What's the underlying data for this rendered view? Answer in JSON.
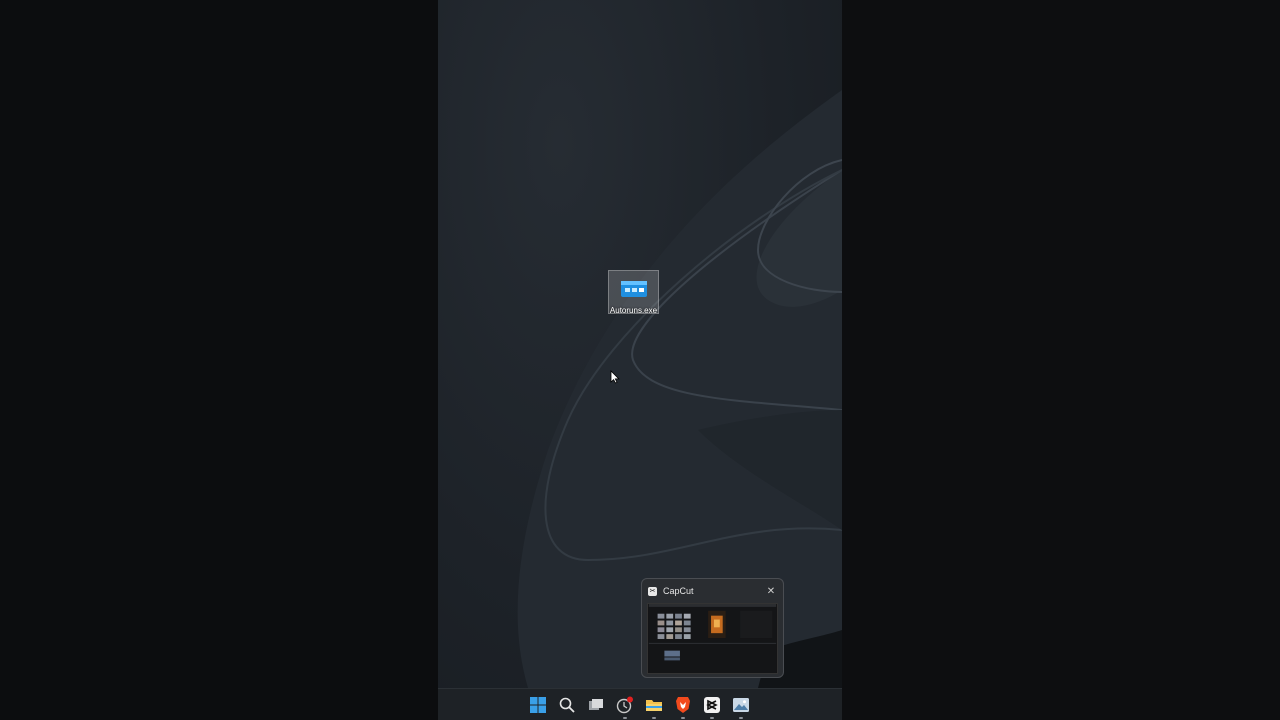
{
  "desktop": {
    "icons": [
      {
        "label": "Autoruns.exe",
        "icon": "autoruns-app-icon"
      }
    ]
  },
  "taskbar_preview": {
    "title": "CapCut",
    "app_icon": "capcut-icon",
    "close_icon": "close-icon"
  },
  "taskbar": {
    "items": [
      {
        "name": "start",
        "icon": "windows-logo-icon"
      },
      {
        "name": "search",
        "icon": "search-icon"
      },
      {
        "name": "task-view",
        "icon": "task-view-icon"
      },
      {
        "name": "app-red-badge",
        "icon": "app-icon"
      },
      {
        "name": "file-explorer",
        "icon": "folder-icon"
      },
      {
        "name": "brave",
        "icon": "brave-browser-icon"
      },
      {
        "name": "capcut",
        "icon": "capcut-icon"
      },
      {
        "name": "photos",
        "icon": "photos-icon"
      }
    ]
  },
  "colors": {
    "accent": "#3aa0e8",
    "wallpaper": "#1d2228",
    "taskbar": "#1e2226"
  }
}
